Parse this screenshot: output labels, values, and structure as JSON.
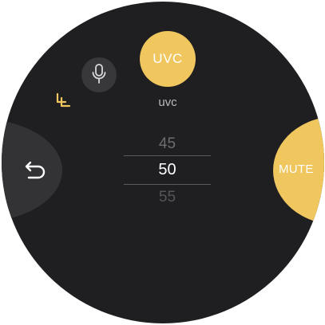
{
  "screen": {
    "title_button": "UVC",
    "subtitle": "uvc"
  },
  "actions": {
    "back_icon": "back-arrow-icon",
    "mute_label": "MUTE",
    "mic_icon": "microphone-icon",
    "collapse_icon": "collapse-chevrons-icon"
  },
  "picker": {
    "previous": "45",
    "current": "50",
    "next": "55"
  },
  "colors": {
    "accent": "#f0c65e",
    "background": "#1f1f21",
    "button_dark": "#333336",
    "text_primary": "#ffffff",
    "text_muted": "#b9b9bd"
  }
}
